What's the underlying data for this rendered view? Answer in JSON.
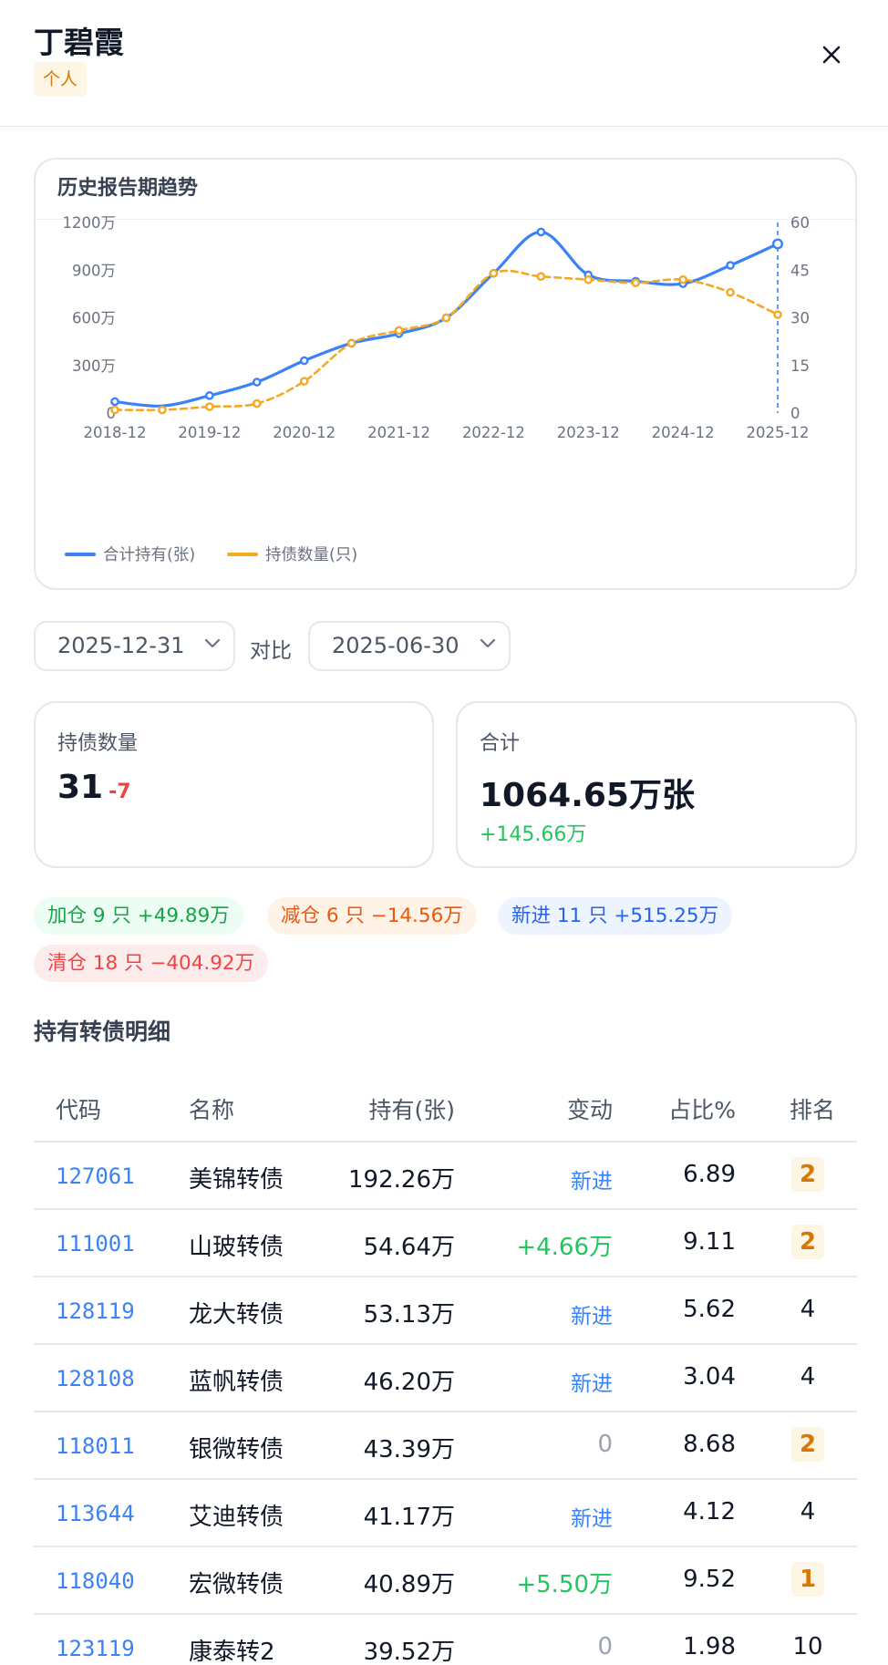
{
  "header": {
    "title": "丁碧霞",
    "tag": "个人"
  },
  "chart_card": {
    "title": "历史报告期趋势"
  },
  "chart_data": {
    "type": "line",
    "title": "",
    "categories": [
      "2018-12",
      "2019-06",
      "2019-12",
      "2020-06",
      "2020-12",
      "2021-06",
      "2021-12",
      "2022-06",
      "2022-12",
      "2023-06",
      "2023-12",
      "2024-06",
      "2024-12",
      "2025-06",
      "2025-12"
    ],
    "x_tick_labels": [
      "2018-12",
      "2019-12",
      "2020-12",
      "2021-12",
      "2022-12",
      "2023-12",
      "2024-12",
      "2025-12"
    ],
    "y_left_ticks": [
      "1200万",
      "900万",
      "600万",
      "300万",
      "0"
    ],
    "y_right_ticks": [
      "60",
      "45",
      "30",
      "15",
      "0"
    ],
    "y_left_lim": [
      0,
      1200
    ],
    "y_right_lim": [
      0,
      60
    ],
    "series": [
      {
        "name": "合计持有(张)",
        "axis": "left",
        "unit": "万张",
        "color": "#3b82f6",
        "values": [
          72,
          45,
          110,
          195,
          330,
          440,
          500,
          600,
          880,
          1140,
          870,
          830,
          815,
          930,
          1065
        ]
      },
      {
        "name": "持债数量(只)",
        "axis": "right",
        "unit": "只",
        "color": "#f4a920",
        "values": [
          1,
          1,
          2,
          3,
          10,
          22,
          26,
          30,
          44,
          43,
          42,
          41,
          42,
          38,
          31
        ]
      }
    ],
    "legend_position": "bottom-left",
    "grid": false
  },
  "filters": {
    "date_primary": "2025-12-31",
    "compare_label": "对比",
    "date_compare": "2025-06-30"
  },
  "stats": {
    "count_label": "持债数量",
    "count_value": "31",
    "count_delta": "-7",
    "total_label": "合计",
    "total_value": "1064.65万张",
    "total_delta": "+145.66万"
  },
  "pills": {
    "add": "加仓 9 只 +49.89万",
    "reduce": "减仓 6 只 −14.56万",
    "new": "新进 11 只 +515.25万",
    "clear": "清仓 18 只 −404.92万"
  },
  "section_title": "持有转债明细",
  "table": {
    "headers": {
      "code": "代码",
      "name": "名称",
      "hold": "持有(张)",
      "change": "变动",
      "pct": "占比%",
      "rank": "排名"
    },
    "rows": [
      {
        "code": "127061",
        "name": "美锦转债",
        "hold": "192.26万",
        "change": "新进",
        "change_type": "new",
        "pct": "6.89",
        "rank": "2",
        "rank_highlight": true
      },
      {
        "code": "111001",
        "name": "山玻转债",
        "hold": "54.64万",
        "change": "+4.66万",
        "change_type": "up",
        "pct": "9.11",
        "rank": "2",
        "rank_highlight": true
      },
      {
        "code": "128119",
        "name": "龙大转债",
        "hold": "53.13万",
        "change": "新进",
        "change_type": "new",
        "pct": "5.62",
        "rank": "4",
        "rank_highlight": false
      },
      {
        "code": "128108",
        "name": "蓝帆转债",
        "hold": "46.20万",
        "change": "新进",
        "change_type": "new",
        "pct": "3.04",
        "rank": "4",
        "rank_highlight": false
      },
      {
        "code": "118011",
        "name": "银微转债",
        "hold": "43.39万",
        "change": "0",
        "change_type": "zero",
        "pct": "8.68",
        "rank": "2",
        "rank_highlight": true
      },
      {
        "code": "113644",
        "name": "艾迪转债",
        "hold": "41.17万",
        "change": "新进",
        "change_type": "new",
        "pct": "4.12",
        "rank": "4",
        "rank_highlight": false
      },
      {
        "code": "118040",
        "name": "宏微转债",
        "hold": "40.89万",
        "change": "+5.50万",
        "change_type": "up",
        "pct": "9.52",
        "rank": "1",
        "rank_highlight": true
      },
      {
        "code": "123119",
        "name": "康泰转2",
        "hold": "39.52万",
        "change": "0",
        "change_type": "zero",
        "pct": "1.98",
        "rank": "10",
        "rank_highlight": false
      }
    ]
  },
  "colors": {
    "accent_blue": "#3b82f6",
    "accent_orange": "#f4a920",
    "positive": "#22c55e",
    "negative": "#ef4444",
    "badge": "#d97706"
  }
}
